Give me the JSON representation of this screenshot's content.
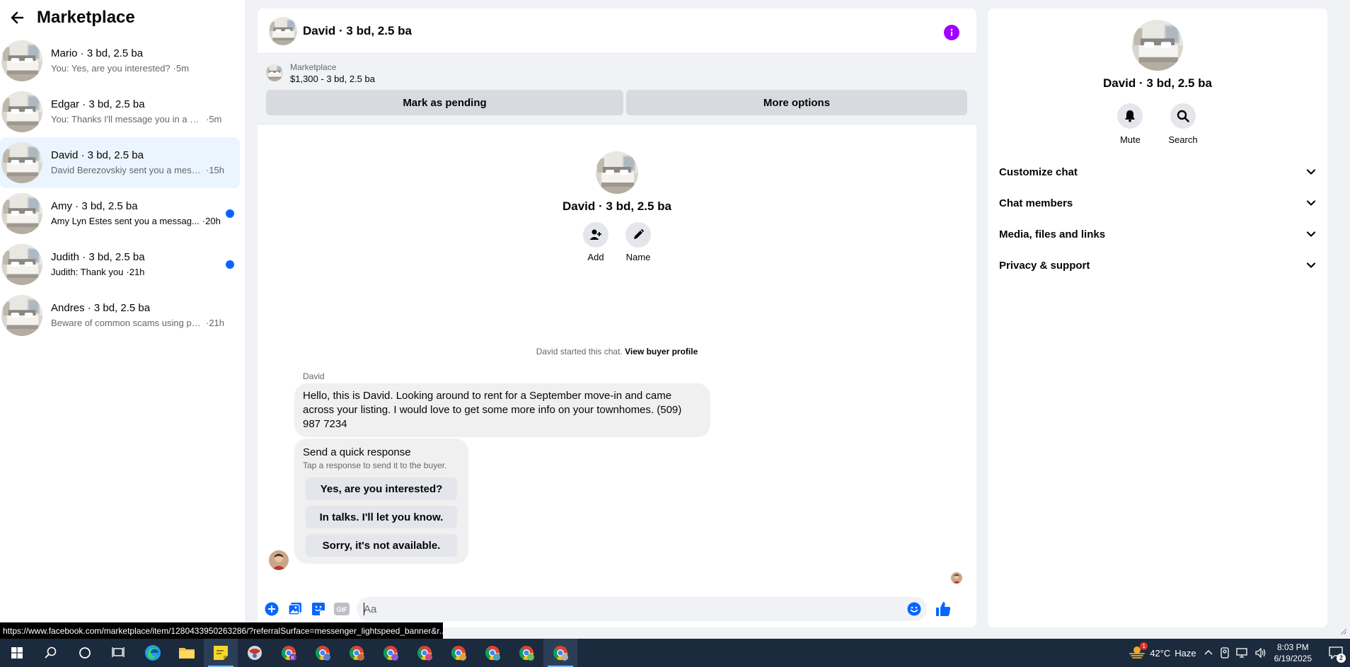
{
  "sidebar": {
    "title": "Marketplace",
    "conversations": [
      {
        "name": "Mario · 3 bd, 2.5 ba",
        "preview": "You: Yes, are you interested?",
        "time": "·5m",
        "unread": false,
        "active": false
      },
      {
        "name": "Edgar · 3 bd, 2.5 ba",
        "preview": "You: Thanks I'll message you in a mo...",
        "time": "·5m",
        "unread": false,
        "active": false
      },
      {
        "name": "David · 3 bd, 2.5 ba",
        "preview": "David Berezovskiy sent you a messa...",
        "time": "·15h",
        "unread": false,
        "active": true
      },
      {
        "name": "Amy · 3 bd, 2.5 ba",
        "preview": "Amy Lyn Estes sent you a messag...",
        "time": "·20h",
        "unread": true,
        "active": false
      },
      {
        "name": "Judith · 3 bd, 2.5 ba",
        "preview": "Judith: Thank you",
        "time": "·21h",
        "unread": true,
        "active": false
      },
      {
        "name": "Andres · 3 bd, 2.5 ba",
        "preview": "Beware of common scams using pay...",
        "time": "·21h",
        "unread": false,
        "active": false
      }
    ]
  },
  "chat": {
    "title": "David · 3 bd, 2.5 ba",
    "listing": {
      "source": "Marketplace",
      "price_title": "$1,300 - 3 bd, 2.5 ba",
      "mark_pending": "Mark as pending",
      "more_options": "More options"
    },
    "intro": {
      "name": "David · 3 bd, 2.5 ba",
      "add_label": "Add",
      "name_label": "Name"
    },
    "system": {
      "started": "David started this chat.",
      "view_profile": "View buyer profile"
    },
    "message": {
      "sender": "David",
      "text": "Hello, this is David. Looking around to rent for a September move-in and came across your listing. I would love to get some more info on your townhomes. (509) 987 7234"
    },
    "quick_response": {
      "title": "Send a quick response",
      "subtitle": "Tap a response to send it to the buyer.",
      "options": [
        "Yes, are you interested?",
        "In talks. I'll let you know.",
        "Sorry, it's not available."
      ]
    },
    "composer": {
      "placeholder": "Aa",
      "value": "",
      "gif_label": "GIF"
    }
  },
  "details": {
    "name": "David · 3 bd, 2.5 ba",
    "mute_label": "Mute",
    "search_label": "Search",
    "sections": [
      "Customize chat",
      "Chat members",
      "Media, files and links",
      "Privacy & support"
    ]
  },
  "status_url": "https://www.facebook.com/marketplace/item/1280433950263286/?referralSurface=messenger_lightspeed_banner&r...",
  "taskbar": {
    "weather_temp": "42°C",
    "weather_text": "Haze",
    "weather_badge": "1",
    "time": "8:03 PM",
    "date": "6/19/2025",
    "notification_count": "2"
  },
  "colors": {
    "accent": "#0866ff",
    "info": "#a100ff",
    "active_row": "#ebf5ff",
    "taskbar": "#1b2a3d"
  }
}
